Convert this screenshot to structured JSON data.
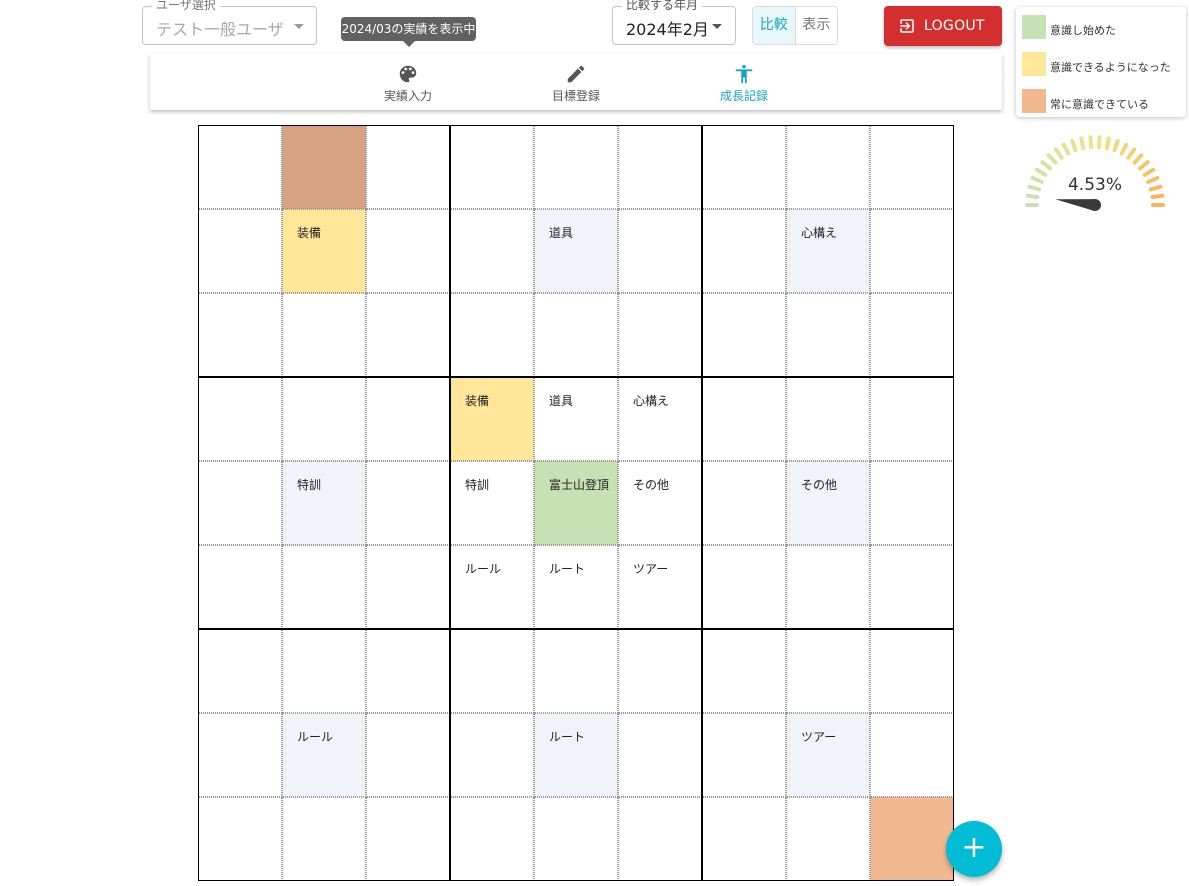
{
  "user_select": {
    "label": "ユーザ選択",
    "value": "テスト一般ユーザ"
  },
  "tooltip": "2024/03の実績を表示中",
  "month_select": {
    "label": "比較する年月",
    "value": "2024年2月"
  },
  "toggle": {
    "compare": "比較",
    "display": "表示",
    "active": "compare"
  },
  "logout_label": "LOGOUT",
  "legend": [
    {
      "label": "意識し始めた",
      "color": "#c7e0b4"
    },
    {
      "label": "意識できるようになった",
      "color": "#ffe699"
    },
    {
      "label": "常に意識できている",
      "color": "#f2b991"
    }
  ],
  "nav": [
    {
      "label": "実績入力",
      "icon": "palette-icon",
      "active": false
    },
    {
      "label": "目標登録",
      "icon": "edit-icon",
      "active": false
    },
    {
      "label": "成長記録",
      "icon": "accessibility-icon",
      "active": true
    }
  ],
  "gauge": {
    "value_text": "4.53%",
    "value": 4.53
  },
  "grid": {
    "colors": {
      "ans": "#d6a180",
      "1": "#c7e0b4",
      "2": "#ffe699",
      "3": "#f2b991",
      "sat": "#f0f4f9"
    },
    "cells": [
      [
        "",
        "",
        "",
        "",
        "",
        "",
        "",
        "",
        ""
      ],
      [
        "",
        "装備",
        "",
        "",
        "道具",
        "",
        "",
        "心構え",
        ""
      ],
      [
        "",
        "",
        "",
        "",
        "",
        "",
        "",
        "",
        ""
      ],
      [
        "",
        "",
        "",
        "装備",
        "道具",
        "心構え",
        "",
        "",
        ""
      ],
      [
        "",
        "特訓",
        "",
        "特訓",
        "富士山登頂",
        "その他",
        "",
        "その他",
        ""
      ],
      [
        "",
        "",
        "",
        "ルール",
        "ルート",
        "ツアー",
        "",
        "",
        ""
      ],
      [
        "",
        "",
        "",
        "",
        "",
        "",
        "",
        "",
        ""
      ],
      [
        "",
        "ルール",
        "",
        "",
        "ルート",
        "",
        "",
        "ツアー",
        ""
      ],
      [
        "",
        "",
        "",
        "",
        "",
        "",
        "",
        "",
        ""
      ]
    ],
    "status": [
      [
        "",
        "ans",
        "",
        "",
        "",
        "",
        "",
        "",
        ""
      ],
      [
        "",
        "2",
        "",
        "",
        "sat",
        "",
        "",
        "sat",
        ""
      ],
      [
        "",
        "",
        "",
        "",
        "",
        "",
        "",
        "",
        ""
      ],
      [
        "",
        "",
        "",
        "2",
        "",
        "",
        "",
        "",
        ""
      ],
      [
        "",
        "sat",
        "",
        "",
        "1",
        "",
        "",
        "sat",
        ""
      ],
      [
        "",
        "",
        "",
        "",
        "",
        "",
        "",
        "",
        ""
      ],
      [
        "",
        "",
        "",
        "",
        "",
        "",
        "",
        "",
        ""
      ],
      [
        "",
        "sat",
        "",
        "",
        "sat",
        "",
        "",
        "sat",
        ""
      ],
      [
        "",
        "",
        "",
        "",
        "",
        "",
        "",
        "",
        "3"
      ]
    ]
  },
  "fab_label": "+"
}
